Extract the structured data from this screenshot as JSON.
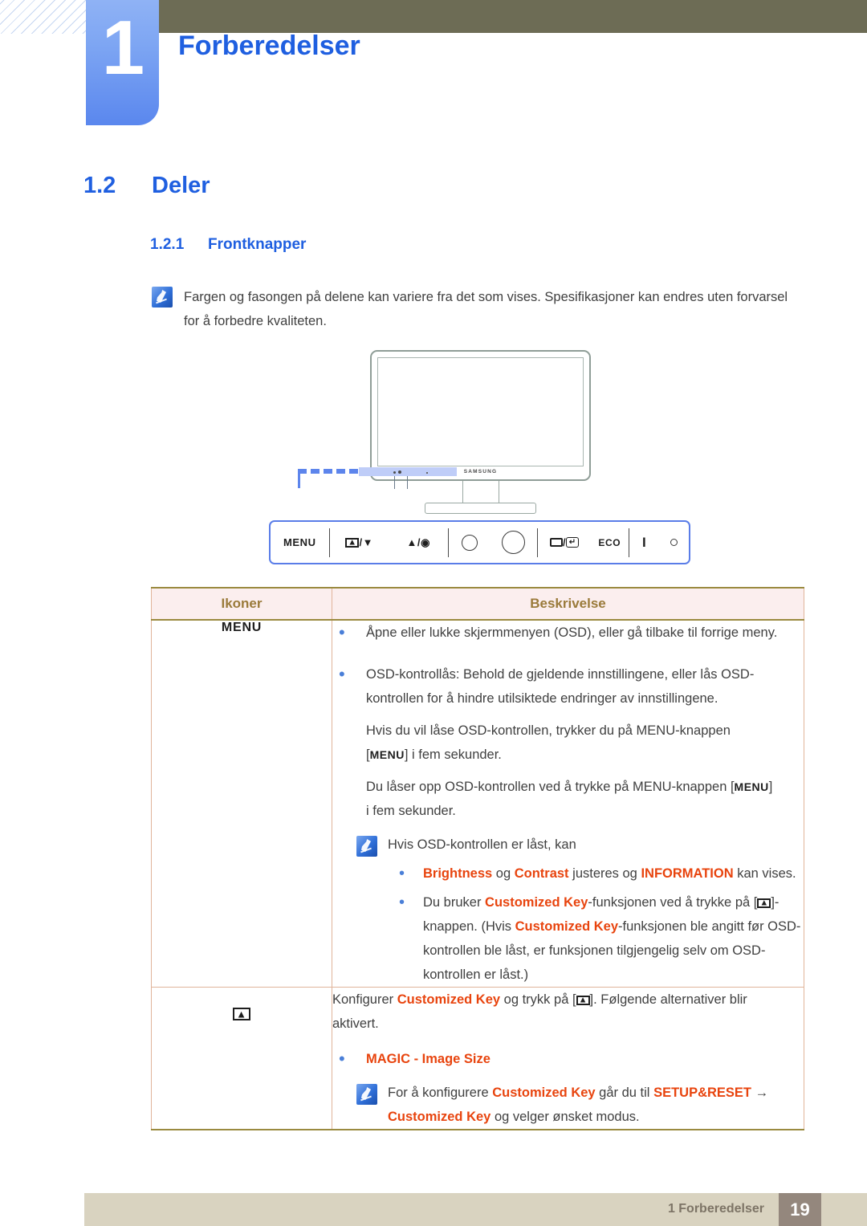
{
  "chapter": {
    "number": "1",
    "title": "Forberedelser"
  },
  "headings": {
    "section_number": "1.2",
    "section_title": "Deler",
    "subsection_number": "1.2.1",
    "subsection_title": "Frontknapper"
  },
  "top_note": {
    "icon": "note-pen-icon",
    "line1": "Fargen og fasongen på delene kan variere fra det som vises. Spesifikasjoner kan endres uten forvarsel",
    "line2": "for å forbedre kvaliteten."
  },
  "figure": {
    "brand": "SAMSUNG",
    "buttons": [
      {
        "name": "menu-button",
        "label": "MENU"
      },
      {
        "name": "customized-key-down-button",
        "label": "/▼"
      },
      {
        "name": "up-enter-button",
        "label": "▲/"
      },
      {
        "name": "small-circle-button",
        "label": ""
      },
      {
        "name": "large-circle-button",
        "label": ""
      },
      {
        "name": "source-enter-button",
        "label": "/"
      },
      {
        "name": "eco-button",
        "label": "ECO"
      },
      {
        "name": "power-button",
        "label": ""
      },
      {
        "name": "power-indicator",
        "label": ""
      }
    ]
  },
  "table": {
    "headers": {
      "icons": "Ikoner",
      "description": "Beskrivelse"
    },
    "rows": [
      {
        "icon_label": "MENU",
        "bullet1": "Åpne eller lukke skjermmenyen (OSD), eller gå tilbake til forrige meny.",
        "bullet2": "OSD-kontrollås: Behold de gjeldende innstillingene, eller lås OSD-kontrollen for å hindre utilsiktede endringer av innstillingene.",
        "para1_a": "Hvis du vil låse OSD-kontrollen, trykker du på MENU-knappen",
        "para1_b_pre": "[",
        "para1_b_key": "MENU",
        "para1_b_post": "] i fem sekunder.",
        "para2_a": "Du låser opp OSD-kontrollen ved å trykke på MENU-knappen [",
        "para2_key": "MENU",
        "para2_b": "]",
        "para2_c": "i fem sekunder.",
        "note_intro": "Hvis OSD-kontrollen er låst, kan",
        "note_bullet_1": "Brightness",
        "note_bullet_1_mid": " og ",
        "note_bullet_2": "Contrast",
        "note_bullet_2_mid": " justeres og ",
        "note_bullet_3": "INFORMATION",
        "note_bullet_3_post": " kan vises.",
        "note_b2_pre": "Du bruker ",
        "note_b2_hl1": "Customized Key",
        "note_b2_mid": "-funksjonen ved å trykke på [",
        "note_b2_post": "]-",
        "note_b2_l2_pre": "knappen. (Hvis ",
        "note_b2_l2_hl": "Customized Key",
        "note_b2_l2_post": "-funksjonen ble angitt før OSD-",
        "note_b2_l3": "kontrollen ble låst, er funksjonen tilgjengelig selv om OSD-",
        "note_b2_l4": "kontrollen er låst.)"
      },
      {
        "icon_label": "customized-key-icon",
        "para_a_pre": "Konfigurer ",
        "para_a_hl": "Customized Key",
        "para_a_mid": " og trykk på [",
        "para_a_post": "]. Følgende alternativer blir",
        "para_a_l2": "aktivert.",
        "bullet_magic": "MAGIC - Image Size",
        "note_pre": "For å konfigurere ",
        "note_hl1": "Customized Key",
        "note_mid": " går du til ",
        "note_hl2": "SETUP&RESET",
        "note_arrow": " →",
        "note_l2_hl": "Customized Key",
        "note_l2_post": " og velger ønsket modus."
      }
    ]
  },
  "footer": {
    "text": "1 Forberedelser",
    "page": "19"
  },
  "colors": {
    "accent_blue": "#1f5fe0",
    "olive": "#6d6c55",
    "highlight_orange": "#e8440e",
    "table_header_bg": "#fbeeee",
    "table_header_text": "#9a7a3a",
    "footer_bg": "#d9d3c0",
    "page_box_bg": "#94877d"
  }
}
